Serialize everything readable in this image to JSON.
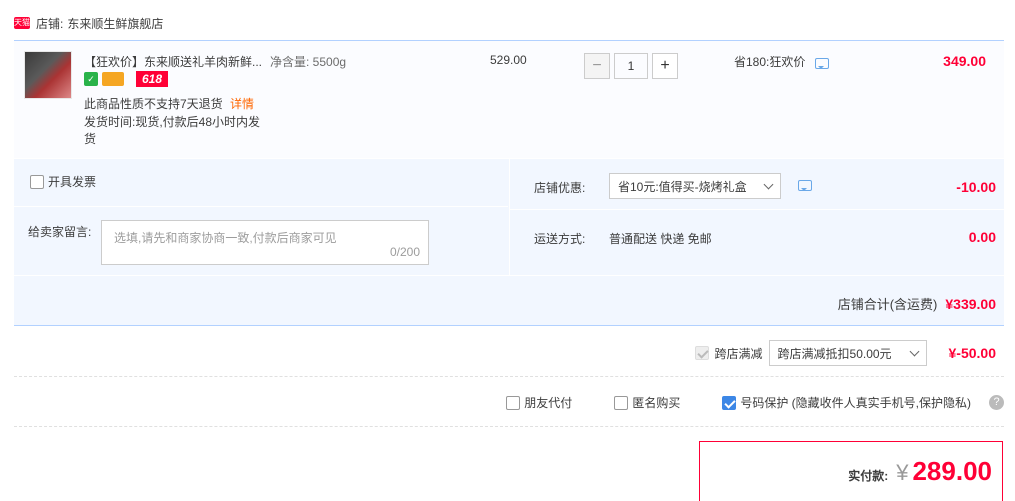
{
  "store": {
    "logo_text": "天猫",
    "label": "店铺:",
    "name": "东来顺生鲜旗舰店"
  },
  "item": {
    "title": "【狂欢价】东来顺送礼羊肉新鲜...",
    "spec": "净含量: 5500g",
    "badge_618": "618",
    "no_return": "此商品性质不支持7天退货",
    "detail_link": "详情",
    "ship_time": "发货时间:现货,付款后48小时内发货",
    "price": "529.00",
    "qty_minus": "−",
    "qty_value": "1",
    "qty_plus": "+",
    "saving": "省180:狂欢价",
    "line_total": "349.00"
  },
  "options": {
    "invoice_label": "开具发票",
    "message_label": "给卖家留言:",
    "message_placeholder": "选填,请先和商家协商一致,付款后商家可见",
    "message_count": "0/200",
    "shop_discount_label": "店铺优惠:",
    "shop_discount_value": "省10元:值得买-烧烤礼盒",
    "shop_discount_amount": "-10.00",
    "shipping_label": "运送方式:",
    "shipping_value": "普通配送 快递 免邮",
    "shipping_amount": "0.00",
    "store_total_label": "店铺合计(含运费)",
    "store_total_amount": "¥339.00"
  },
  "cross_store": {
    "label": "跨店满减",
    "select_value": "跨店满减抵扣50.00元",
    "amount": "¥-50.00"
  },
  "extras": {
    "friend_pay": "朋友代付",
    "anonymous": "匿名购买",
    "privacy": "号码保护 (隐藏收件人真实手机号,保护隐私)",
    "help": "?"
  },
  "payment": {
    "label": "实付款:",
    "currency": "¥",
    "amount": "289.00"
  },
  "colors": {
    "accent_red": "#ff0036",
    "border_blue": "#b2d1ff",
    "bg_blue": "#f2f7ff",
    "check_blue": "#3c87e6"
  }
}
